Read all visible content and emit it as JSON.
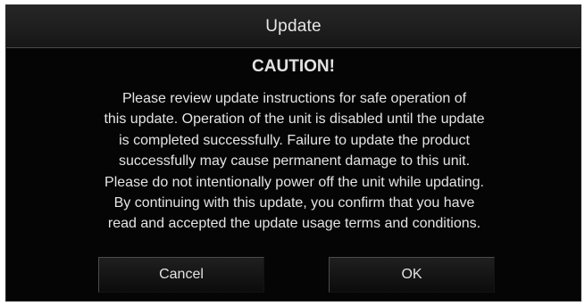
{
  "dialog": {
    "title": "Update",
    "heading": "CAUTION!",
    "message_lines": [
      "Please review update instructions for safe operation of",
      "this update.  Operation of the unit is disabled until the update",
      "is completed successfully.  Failure to update the product",
      "successfully may cause permanent damage to this unit.",
      "Please do not intentionally power off the unit while updating.",
      "By continuing with this update, you confirm that you have",
      "read and accepted the update usage terms and conditions."
    ],
    "buttons": {
      "cancel_label": "Cancel",
      "ok_label": "OK"
    }
  },
  "colors": {
    "background": "#050505",
    "text": "#e4e4e4"
  }
}
